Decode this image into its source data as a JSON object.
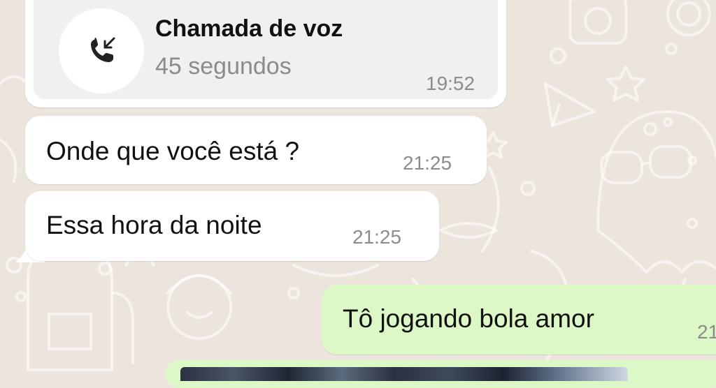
{
  "chat": {
    "call": {
      "title": "Chamada de voz",
      "duration": "45 segundos",
      "time": "19:52",
      "icon": "incoming-call-icon"
    },
    "messages": [
      {
        "direction": "incoming",
        "text": "Onde que você está ?",
        "time": "21:25"
      },
      {
        "direction": "incoming",
        "text": "Essa hora da noite",
        "time": "21:25"
      },
      {
        "direction": "outgoing",
        "text": "Tô jogando bola amor",
        "time": "21"
      }
    ],
    "attachment": {
      "type": "image"
    }
  },
  "colors": {
    "background": "#ece5dd",
    "incoming_bubble": "#ffffff",
    "outgoing_bubble": "#dcf8c6",
    "call_card_inner": "#f0f0f0",
    "timestamp": "#8c8c8c",
    "text": "#111111"
  }
}
